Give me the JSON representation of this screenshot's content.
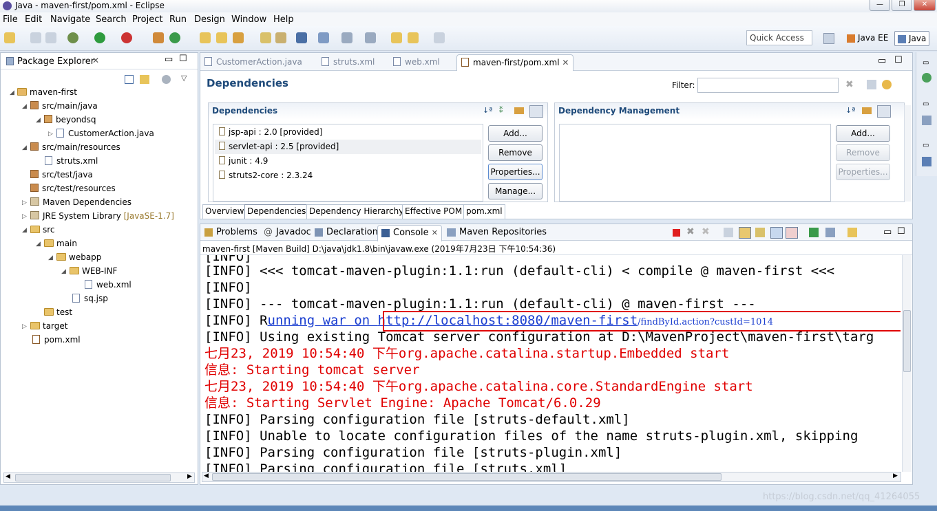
{
  "window": {
    "title": "Java - maven-first/pom.xml - Eclipse"
  },
  "menu": [
    "File",
    "Edit",
    "Navigate",
    "Search",
    "Project",
    "Run",
    "Design",
    "Window",
    "Help"
  ],
  "toolbar": {
    "quick_access": "Quick Access",
    "perspective_javaee": "Java EE",
    "perspective_java": "Java"
  },
  "package_explorer": {
    "title": "Package Explorer",
    "items": [
      {
        "label": "maven-first"
      },
      {
        "label": "src/main/java"
      },
      {
        "label": "beyondsq"
      },
      {
        "label": "CustomerAction.java"
      },
      {
        "label": "src/main/resources"
      },
      {
        "label": "struts.xml"
      },
      {
        "label": "src/test/java"
      },
      {
        "label": "src/test/resources"
      },
      {
        "label": "Maven Dependencies"
      },
      {
        "label": "JRE System Library",
        "suffix": "[JavaSE-1.7]"
      },
      {
        "label": "src"
      },
      {
        "label": "main"
      },
      {
        "label": "webapp"
      },
      {
        "label": "WEB-INF"
      },
      {
        "label": "web.xml"
      },
      {
        "label": "sq.jsp"
      },
      {
        "label": "test"
      },
      {
        "label": "target"
      },
      {
        "label": "pom.xml"
      }
    ]
  },
  "editor": {
    "tabs": [
      "CustomerAction.java",
      "struts.xml",
      "web.xml",
      "maven-first/pom.xml"
    ],
    "heading": "Dependencies",
    "filter_label": "Filter:",
    "dependencies_title": "Dependencies",
    "dependencies": [
      "jsp-api : 2.0 [provided]",
      "servlet-api : 2.5 [provided]",
      "junit : 4.9",
      "struts2-core : 2.3.24"
    ],
    "dep_buttons": [
      "Add...",
      "Remove",
      "Properties...",
      "Manage..."
    ],
    "mgmt_title": "Dependency Management",
    "mgmt_buttons": [
      "Add...",
      "Remove",
      "Properties..."
    ],
    "bottom_tabs": [
      "Overview",
      "Dependencies",
      "Dependency Hierarchy",
      "Effective POM",
      "pom.xml"
    ]
  },
  "console": {
    "tabs": [
      "Problems",
      "Javadoc",
      "Declaration",
      "Console",
      "Maven Repositories"
    ],
    "launch": "maven-first [Maven Build] D:\\java\\jdk1.8\\bin\\javaw.exe (2019年7月23日 下午10:54:36)",
    "lines": [
      "[INFO]",
      "[INFO] <<< tomcat-maven-plugin:1.1:run (default-cli) < compile @ maven-first <<<",
      "[INFO]",
      "[INFO] --- tomcat-maven-plugin:1.1:run (default-cli) @ maven-first ---",
      "[INFO] Using existing Tomcat server configuration at D:\\MavenProject\\maven-first\\targ",
      "七月23, 2019 10:54:40 下午org.apache.catalina.startup.Embedded start",
      "信息: Starting tomcat server",
      "七月23, 2019 10:54:40 下午org.apache.catalina.core.StandardEngine start",
      "信息: Starting Servlet Engine: Apache Tomcat/6.0.29",
      "[INFO] Parsing configuration file [struts-default.xml]",
      "[INFO] Unable to locate configuration files of the name struts-plugin.xml, skipping",
      "[INFO] Parsing configuration file [struts-plugin.xml]",
      "[INFO] Parsing configuration file [struts.xml]"
    ],
    "running_prefix": "[INFO] R",
    "running_text": "unning war on ",
    "url": "http://localhost:8080/maven-first",
    "url_suffix": "/findById.action?custId=1014"
  },
  "watermark": "https://blog.csdn.net/qq_41264055"
}
